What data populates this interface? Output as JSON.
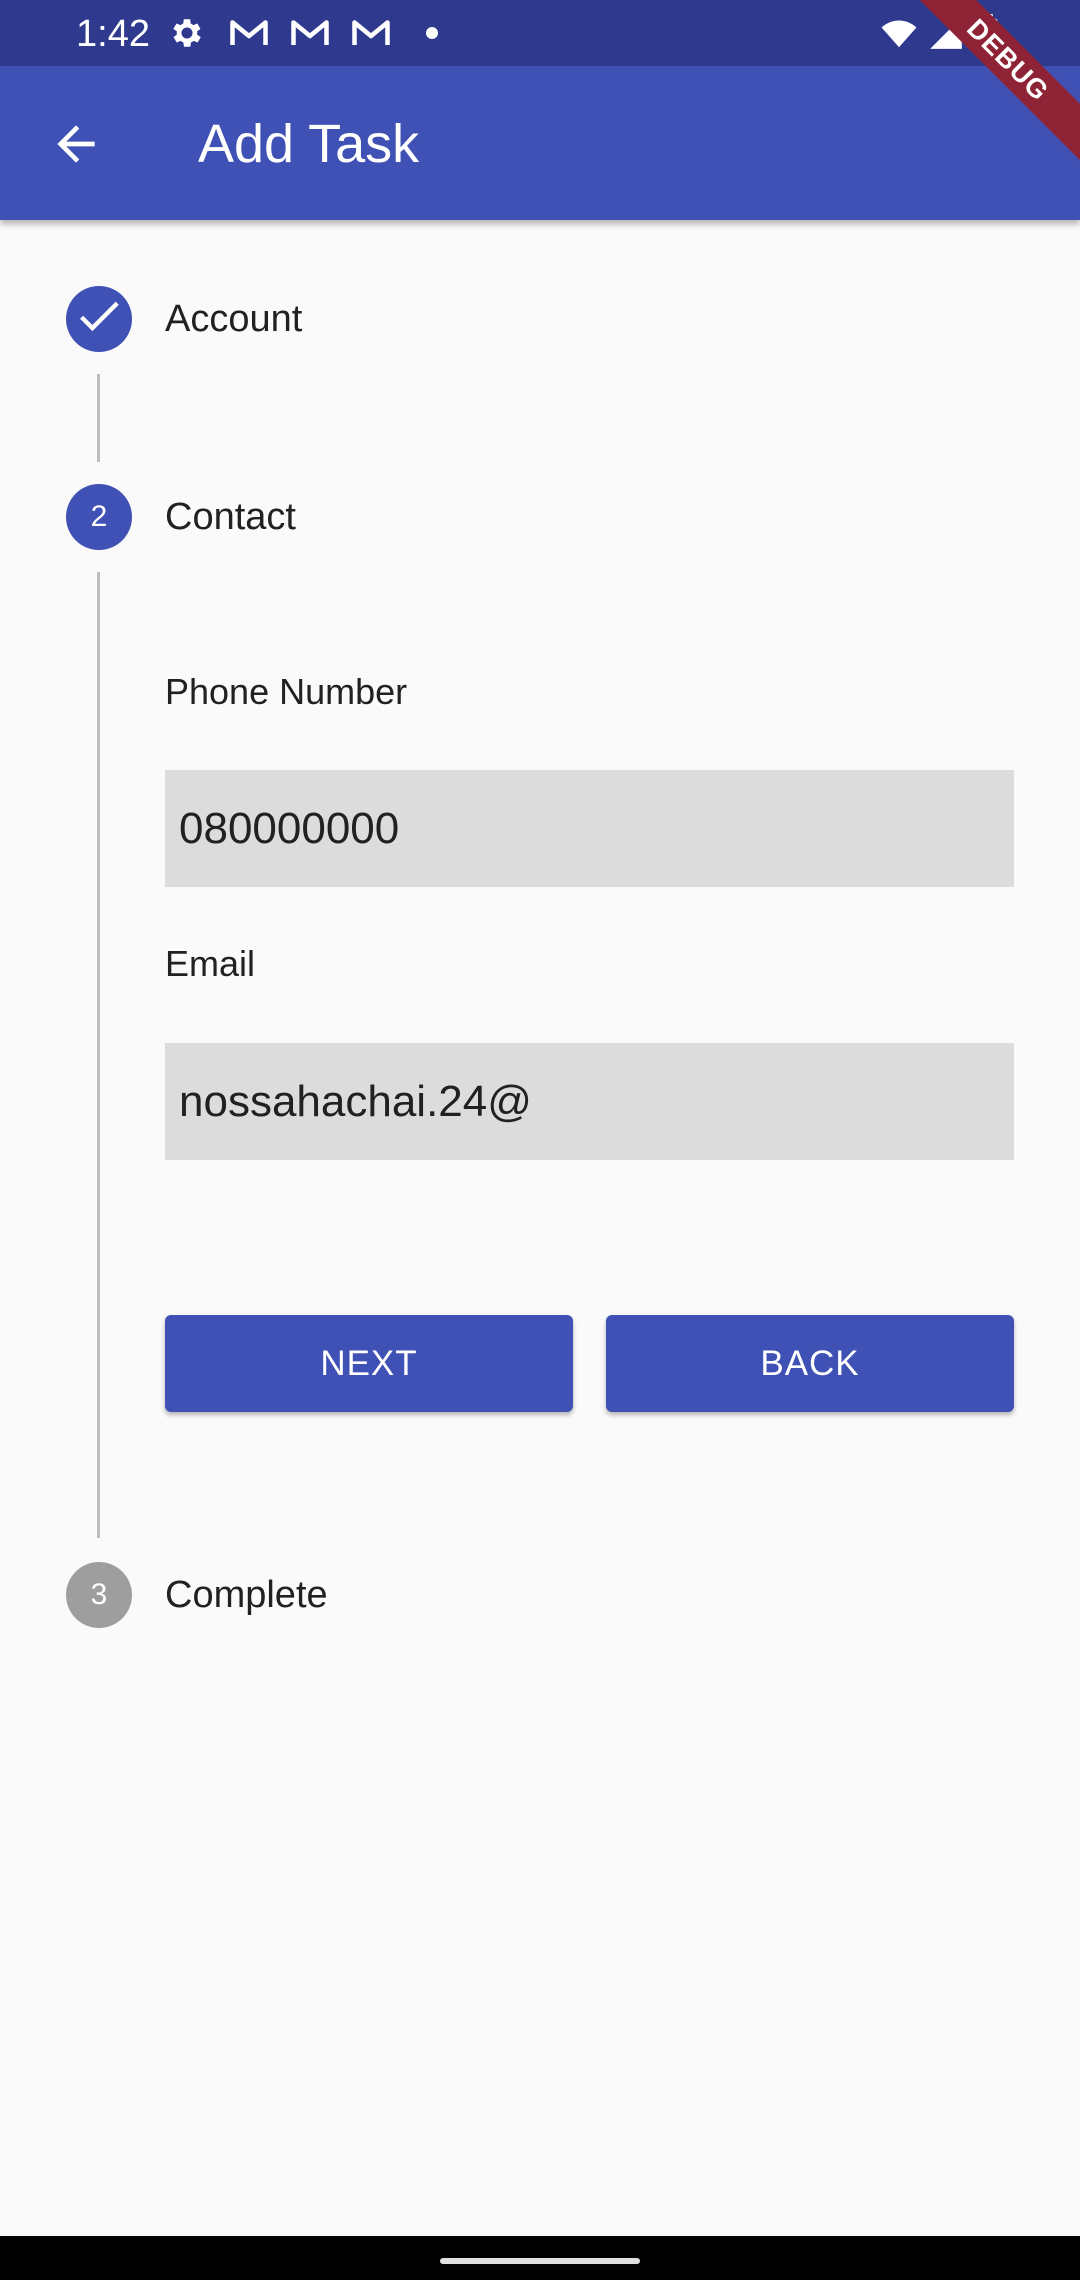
{
  "status_bar": {
    "time": "1:42",
    "icons": [
      "settings-icon",
      "gmail-icon",
      "gmail-icon",
      "gmail-icon",
      "notification-dot-icon",
      "wifi-icon",
      "signal-icon",
      "battery-icon"
    ]
  },
  "app_bar": {
    "title": "Add Task",
    "back_icon": "arrow-back-icon",
    "color": "#3f51b5"
  },
  "debug_banner": "DEBUG",
  "stepper": {
    "steps": [
      {
        "label": "Account",
        "state": "complete",
        "icon": "check-icon"
      },
      {
        "label": "Contact",
        "state": "active",
        "number": "2"
      },
      {
        "label": "Complete",
        "state": "inactive",
        "number": "3"
      }
    ],
    "active_color": "#3f51b5",
    "inactive_color": "#9e9e9e"
  },
  "form": {
    "phone_label": "Phone Number",
    "phone_value": "080000000",
    "email_label": "Email",
    "email_value": "nossahachai.24@"
  },
  "buttons": {
    "next": "NEXT",
    "back": "BACK"
  }
}
